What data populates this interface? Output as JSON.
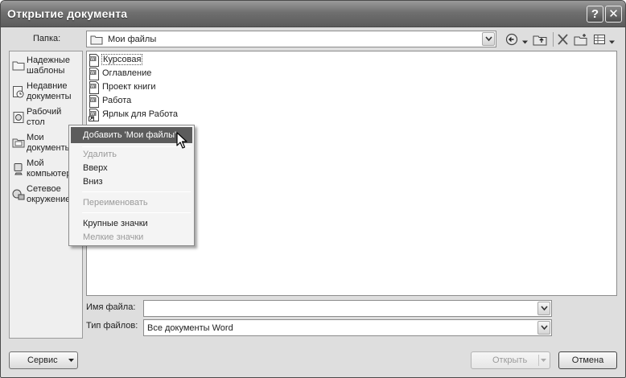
{
  "window": {
    "title": "Открытие документа",
    "help_label": "?",
    "close_label": "✕"
  },
  "location": {
    "label": "Папка:",
    "value": "Мои файлы",
    "folder_icon": "folder-icon"
  },
  "toolbar": {
    "icons": [
      "back-icon",
      "up-folder-icon",
      "delete-icon",
      "new-folder-icon",
      "views-icon"
    ]
  },
  "places": [
    {
      "label": "Надежные\nшаблоны",
      "icon": "folder-icon"
    },
    {
      "label": "Недавние\nдокументы",
      "icon": "recent-icon"
    },
    {
      "label": "Рабочий\nстол",
      "icon": "desktop-icon"
    },
    {
      "label": "Мои\nдокументы",
      "icon": "documents-icon"
    },
    {
      "label": "Мой\nкомпьютер",
      "icon": "computer-icon"
    },
    {
      "label": "Сетевое\nокружение",
      "icon": "network-icon"
    }
  ],
  "files": [
    {
      "name": "Курсовая",
      "icon": "word-doc-icon"
    },
    {
      "name": "Оглавление",
      "icon": "word-doc-icon"
    },
    {
      "name": "Проект книги",
      "icon": "word-doc-icon"
    },
    {
      "name": "Работа",
      "icon": "word-doc-icon"
    },
    {
      "name": "Ярлык для Работа",
      "icon": "word-shortcut-icon"
    }
  ],
  "context_menu": {
    "items": [
      {
        "label": "Добавить 'Мои файлы'",
        "state": "highlighted"
      },
      {
        "label": "Удалить",
        "state": "disabled"
      },
      {
        "label": "Вверх",
        "state": "enabled"
      },
      {
        "label": "Вниз",
        "state": "enabled"
      },
      {
        "label": "Переименовать",
        "state": "disabled"
      },
      {
        "label": "Крупные значки",
        "state": "enabled"
      },
      {
        "label": "Мелкие значки",
        "state": "disabled"
      }
    ]
  },
  "filename": {
    "label": "Имя файла:",
    "value": ""
  },
  "filetype": {
    "label": "Тип файлов:",
    "value": "Все документы Word"
  },
  "buttons": {
    "tools": "Сервис",
    "open": "Открыть",
    "cancel": "Отмена"
  },
  "colors": {
    "titlebar": "#6f6f6f",
    "menu_highlight": "#5c5c5c",
    "disabled_text": "#9a9a9a"
  }
}
